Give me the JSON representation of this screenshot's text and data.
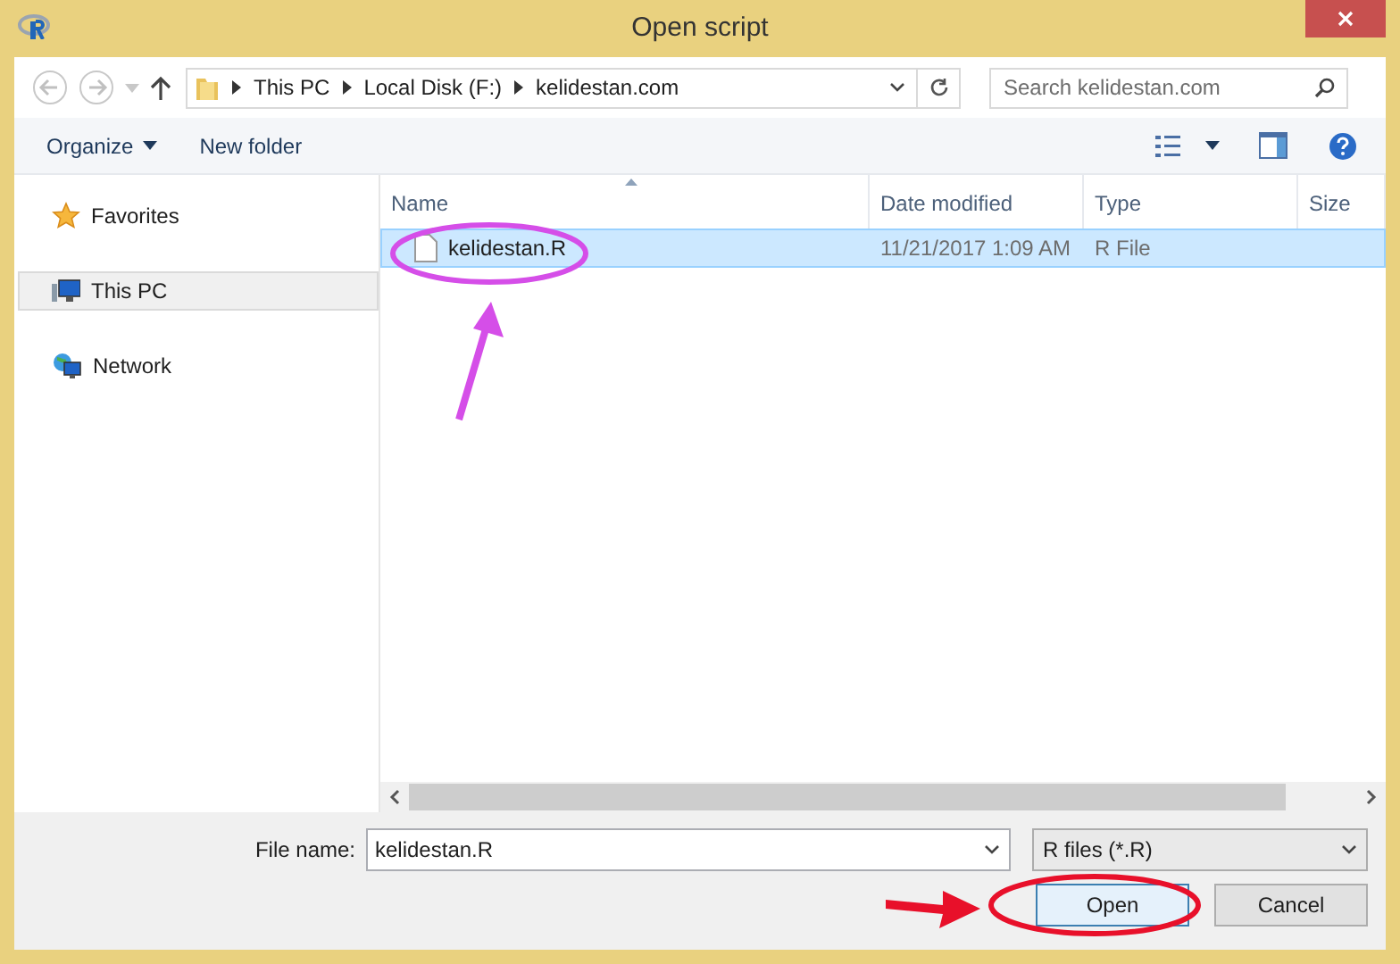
{
  "window": {
    "title": "Open script"
  },
  "breadcrumb": [
    "This PC",
    "Local Disk (F:)",
    "kelidestan.com"
  ],
  "search": {
    "placeholder": "Search kelidestan.com"
  },
  "toolbar": {
    "organize": "Organize",
    "new_folder": "New folder"
  },
  "sidebar": {
    "items": [
      {
        "label": "Favorites",
        "selected": false,
        "kind": "star"
      },
      {
        "label": "This PC",
        "selected": true,
        "kind": "computer"
      },
      {
        "label": "Network",
        "selected": false,
        "kind": "network"
      }
    ]
  },
  "table": {
    "columns": [
      "Name",
      "Date modified",
      "Type",
      "Size"
    ],
    "rows": [
      {
        "name": "kelidestan.R",
        "date": "11/21/2017 1:09 AM",
        "type": "R File",
        "selected": true
      }
    ]
  },
  "file_name": {
    "label": "File name:",
    "value": "kelidestan.R"
  },
  "file_type": {
    "value": "R files (*.R)"
  },
  "buttons": [
    {
      "label": "Open",
      "kind": "primary"
    },
    {
      "label": "Cancel",
      "kind": "secondary"
    }
  ]
}
